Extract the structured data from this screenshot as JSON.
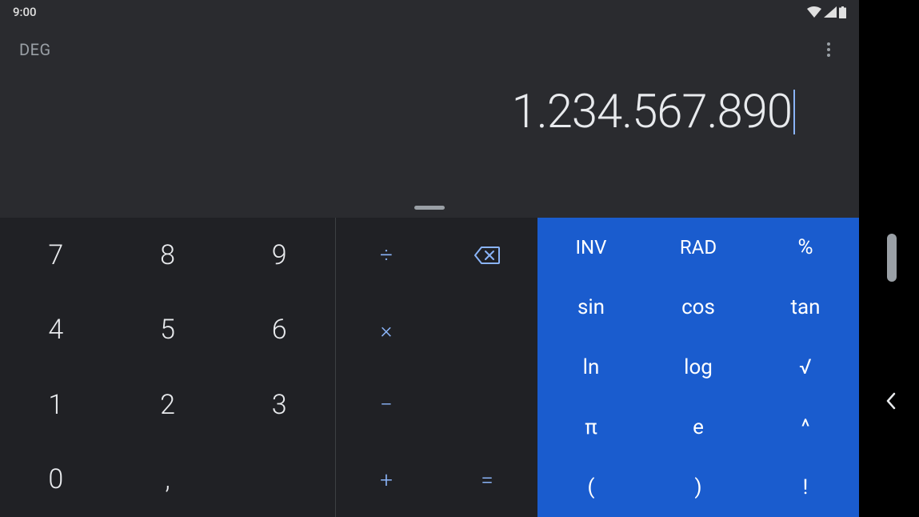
{
  "status_bar": {
    "time": "9:00"
  },
  "display": {
    "mode_label": "DEG",
    "value": "1.234.567.890"
  },
  "numpad": {
    "r1c1": "7",
    "r1c2": "8",
    "r1c3": "9",
    "r2c1": "4",
    "r2c2": "5",
    "r2c3": "6",
    "r3c1": "1",
    "r3c2": "2",
    "r3c3": "3",
    "r4c1": "0",
    "r4c2": ","
  },
  "oppad": {
    "divide": "÷",
    "backspace": "⌫",
    "multiply": "×",
    "minus": "−",
    "plus": "+",
    "equals": "="
  },
  "funcpad": {
    "inv": "INV",
    "rad": "RAD",
    "percent": "%",
    "sin": "sin",
    "cos": "cos",
    "tan": "tan",
    "ln": "ln",
    "log": "log",
    "sqrt": "√",
    "pi": "π",
    "e": "e",
    "pow": "^",
    "lparen": "(",
    "rparen": ")",
    "fact": "!"
  }
}
